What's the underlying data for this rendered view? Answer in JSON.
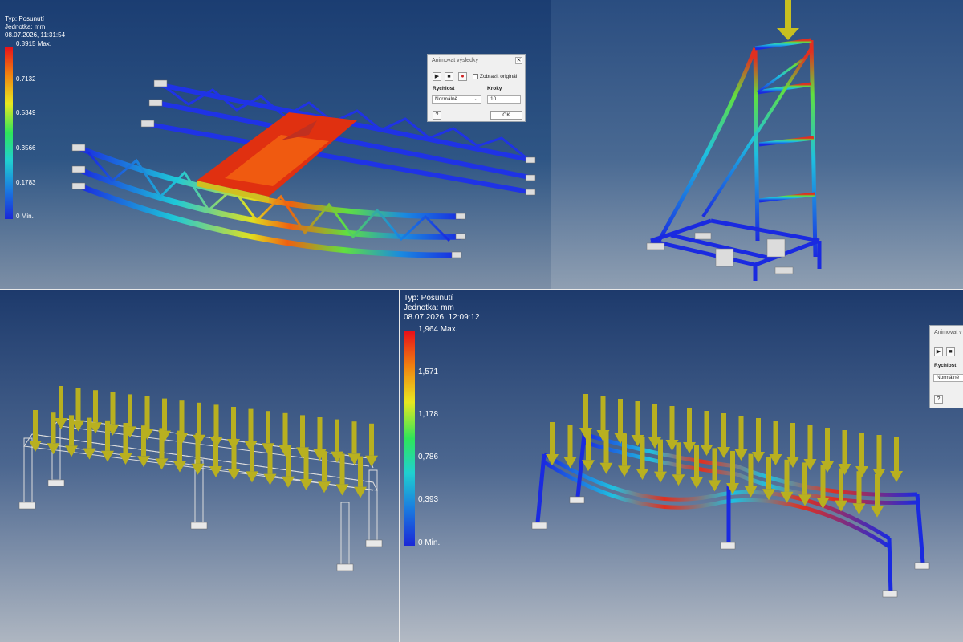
{
  "panel_top_left": {
    "legend": {
      "type_label": "Typ: Posunutí",
      "unit_label": "Jednotka: mm",
      "date_label": "08.07.2026, 11:31:54",
      "max_label": "0.8915 Max.",
      "ticks": [
        "0.7132",
        "0.5349",
        "0.3566",
        "0.1783"
      ],
      "min_label": "0 Min."
    },
    "dialog": {
      "title": "Animovat výsledky",
      "close_glyph": "✕",
      "play_glyph": "▶",
      "stop_glyph": "■",
      "record_glyph": "●",
      "show_original_label": "Zobrazit originál",
      "speed_label": "Rychlost",
      "speed_value": "Normálně",
      "steps_label": "Kroky",
      "steps_value": "10",
      "help_glyph": "?",
      "ok_label": "OK"
    }
  },
  "panel_bottom_right": {
    "legend": {
      "type_label": "Typ: Posunutí",
      "unit_label": "Jednotka: mm",
      "date_label": "08.07.2026, 12:09:12",
      "max_label": "1,964 Max.",
      "ticks": [
        "1,571",
        "1,178",
        "0,786",
        "0,393"
      ],
      "min_label": "0 Min."
    },
    "dialog": {
      "title": "Animovat v",
      "play_glyph": "▶",
      "stop_glyph": "■",
      "speed_label": "Rychlost",
      "speed_value": "Normálně",
      "help_glyph": "?"
    }
  },
  "colors": {
    "legend_top": "#e8101a",
    "legend_mid": "#2ee65a",
    "legend_bottom": "#1a28d8",
    "load_arrow": "#b8b020",
    "dialog_bg": "#f0f0f0"
  }
}
